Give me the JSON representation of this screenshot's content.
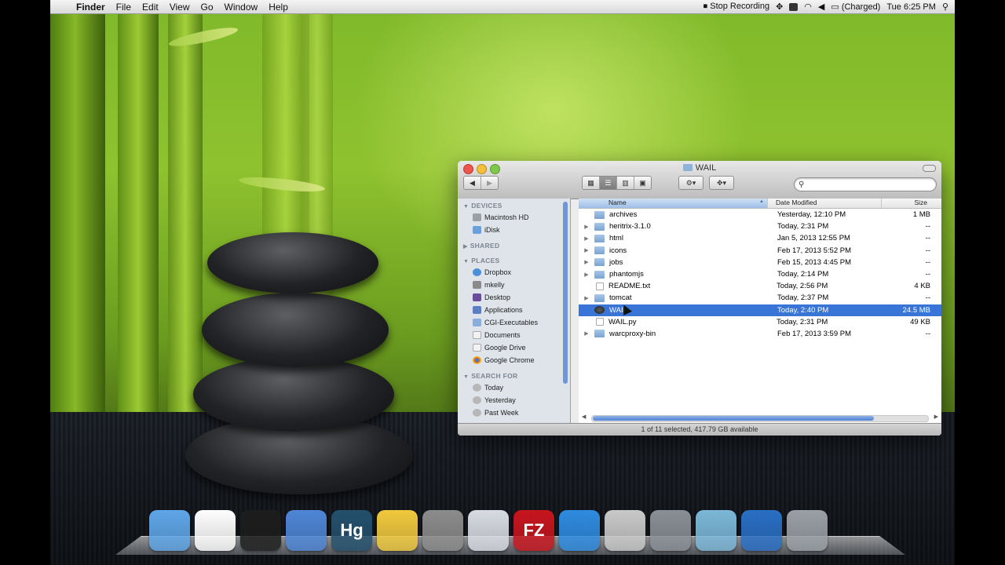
{
  "menubar": {
    "app": "Finder",
    "menus": [
      "File",
      "Edit",
      "View",
      "Go",
      "Window",
      "Help"
    ],
    "stop_recording": "Stop Recording",
    "battery": "(Charged)",
    "clock": "Tue 6:25 PM"
  },
  "window": {
    "title": "WAIL",
    "search_placeholder": "",
    "status": "1 of 11 selected, 417.79 GB available",
    "columns": {
      "name": "Name",
      "date": "Date Modified",
      "size": "Size"
    }
  },
  "sidebar": {
    "devices_label": "DEVICES",
    "devices": [
      "Macintosh HD",
      "iDisk"
    ],
    "shared_label": "SHARED",
    "places_label": "PLACES",
    "places": [
      "Dropbox",
      "mkelly",
      "Desktop",
      "Applications",
      "CGI-Executables",
      "Documents",
      "Google Drive",
      "Google Chrome"
    ],
    "search_label": "SEARCH FOR",
    "search_for": [
      "Today",
      "Yesterday",
      "Past Week"
    ]
  },
  "files": [
    {
      "name": "archives",
      "date": "Yesterday, 12:10 PM",
      "size": "1 MB",
      "kind": "folder",
      "expandable": false
    },
    {
      "name": "heritrix-3.1.0",
      "date": "Today, 2:31 PM",
      "size": "--",
      "kind": "folder",
      "expandable": true
    },
    {
      "name": "html",
      "date": "Jan 5, 2013 12:55 PM",
      "size": "--",
      "kind": "folder",
      "expandable": true
    },
    {
      "name": "icons",
      "date": "Feb 17, 2013 5:52 PM",
      "size": "--",
      "kind": "folder",
      "expandable": true
    },
    {
      "name": "jobs",
      "date": "Feb 15, 2013 4:45 PM",
      "size": "--",
      "kind": "folder",
      "expandable": true
    },
    {
      "name": "phantomjs",
      "date": "Today, 2:14 PM",
      "size": "--",
      "kind": "folder",
      "expandable": true
    },
    {
      "name": "README.txt",
      "date": "Today, 2:56 PM",
      "size": "4 KB",
      "kind": "doc",
      "expandable": false
    },
    {
      "name": "tomcat",
      "date": "Today, 2:37 PM",
      "size": "--",
      "kind": "folder",
      "expandable": true
    },
    {
      "name": "WAIL",
      "date": "Today, 2:40 PM",
      "size": "24.5 MB",
      "kind": "app",
      "expandable": false,
      "selected": true
    },
    {
      "name": "WAIL.py",
      "date": "Today, 2:31 PM",
      "size": "49 KB",
      "kind": "doc",
      "expandable": false
    },
    {
      "name": "warcproxy-bin",
      "date": "Feb 17, 2013 3:59 PM",
      "size": "--",
      "kind": "folder",
      "expandable": true
    }
  ],
  "dock": [
    "finder-icon",
    "chrome-icon",
    "terminal-icon",
    "xcode-icon",
    "hg-icon",
    "wail-icon",
    "scanner-icon",
    "system-icon",
    "filezilla-icon",
    "itunes-icon",
    "utilities-icon",
    "preferences-icon",
    "keychain-icon",
    "quicktime-icon",
    "trash-icon"
  ],
  "dock_labels": {
    "hg": "Hg",
    "filezilla": "FZ"
  }
}
